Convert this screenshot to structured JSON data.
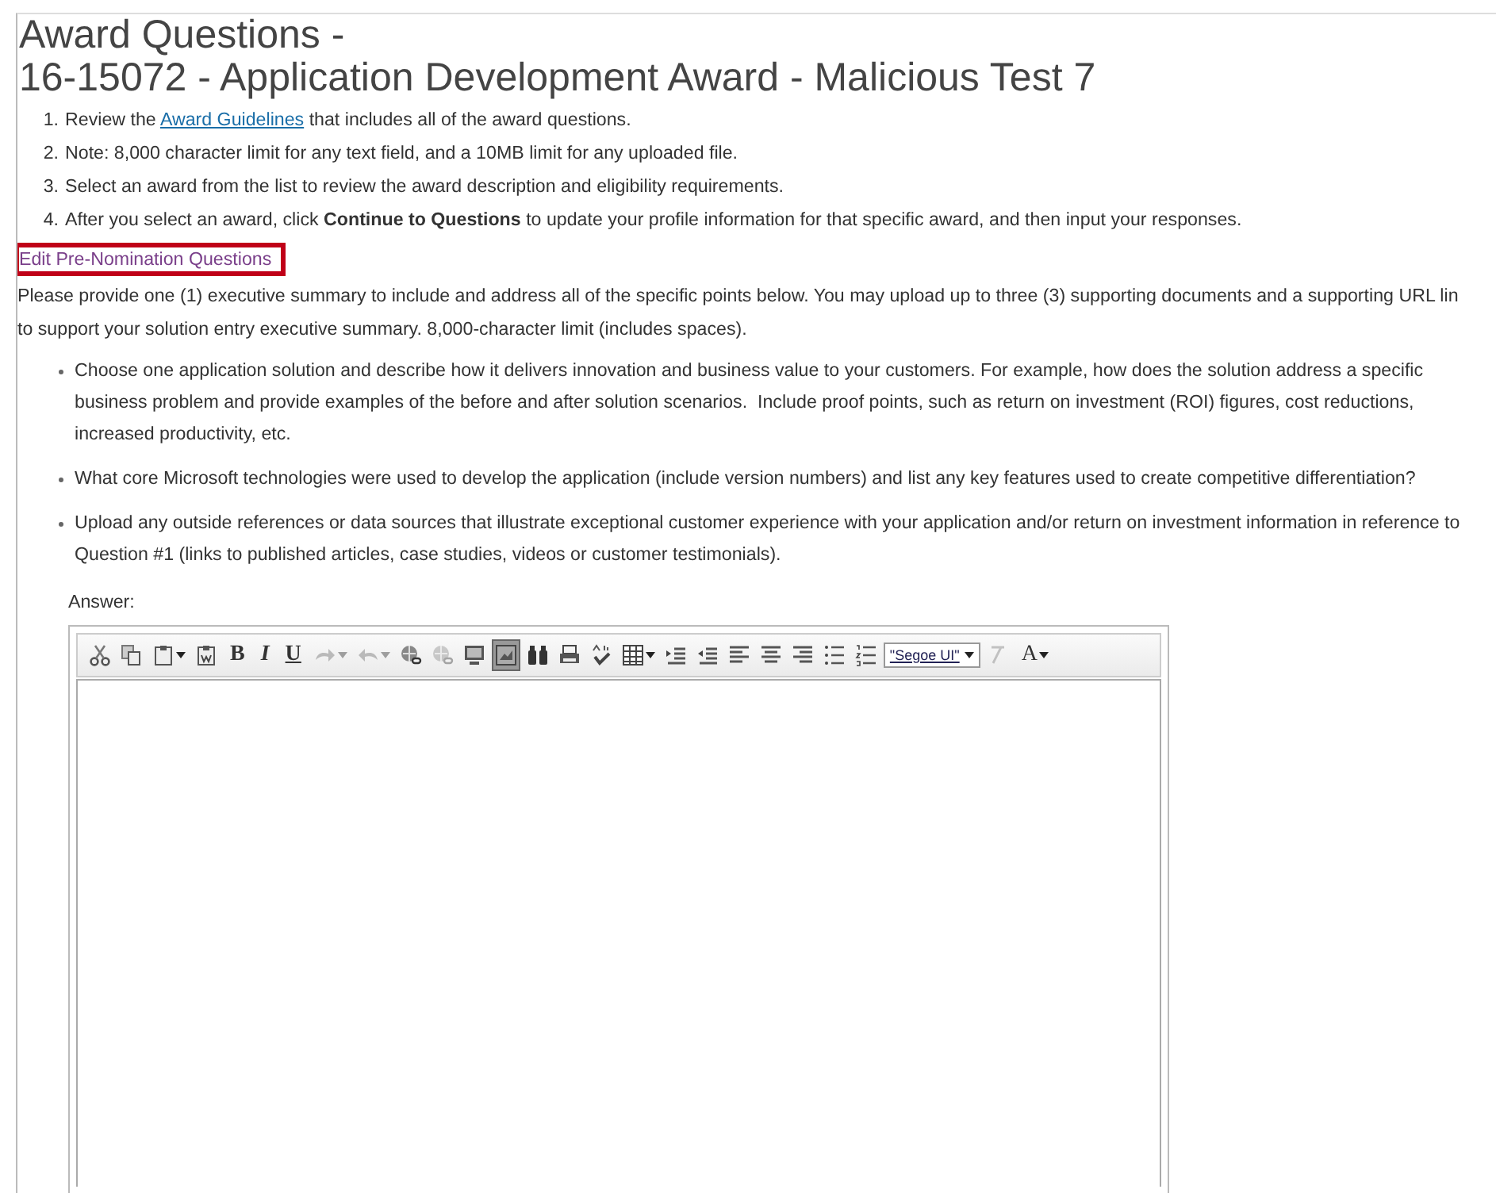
{
  "title": [
    "Award Questions -",
    "16-15072 - Application Development Award - Malicious Test 7"
  ],
  "steps": [
    {
      "number": "1.",
      "text": "Review the ",
      "link": "Award Guidelines",
      "text_after": " that includes all of the award questions."
    },
    {
      "number": "2.",
      "text": "Note: 8,000 character limit for any text field, and a 10MB limit for any uploaded file."
    },
    {
      "number": "3.",
      "text": "Select an award from the list to review the award description and eligibility requirements."
    },
    {
      "number": "4.",
      "text": "After you select an award, click **Continue to Questions** to update your profile information for that specific award, and then input your responses."
    }
  ],
  "section_link": {
    "label": "Edit Pre-Nomination Questions",
    "highlighted": true
  },
  "intro": "Please provide one (1) executive summary to include and address all of the specific points below.  You may upload up to three (3) supporting documents and a supporting URL lin\nto support your solution entry executive summary.  8,000-character limit (includes spaces).",
  "bullets": [
    "Choose one application solution and describe how it delivers innovation and business value to your customers. For example, how does the solution address a specific\nbusiness problem and provide examples of the before and after solution scenarios.  Include proof points, such as return on investment (ROI) figures, cost reductions,\nincreased productivity, etc.",
    "What core Microsoft technologies were used to develop the application (include version numbers) and list any key features used to create competitive differentiation?",
    "Upload any outside references or data sources that illustrate exceptional customer experience with your application and/or return on investment information in reference to\nQuestion #1 (links to published articles, case studies, videos or customer testimonials)."
  ],
  "answer_label": "Answer:",
  "toolbar": [
    {
      "kind": "icon",
      "dropdown": false,
      "disabled": false,
      "pressed": false
    },
    {
      "kind": "icon",
      "dropdown": false,
      "disabled": false,
      "pressed": false
    },
    {
      "kind": "icon",
      "dropdown": true,
      "disabled": false,
      "pressed": false
    },
    {
      "kind": "icon",
      "dropdown": false,
      "disabled": false,
      "pressed": false
    },
    {
      "kind": "text",
      "label": "B",
      "dropdown": false,
      "disabled": false,
      "pressed": false
    },
    {
      "kind": "text",
      "label": "I",
      "dropdown": false,
      "disabled": false,
      "pressed": false
    },
    {
      "kind": "text",
      "label": "U",
      "dropdown": false,
      "disabled": false,
      "pressed": false
    },
    {
      "kind": "icon",
      "dropdown": true,
      "disabled": true,
      "pressed": false
    },
    {
      "kind": "icon",
      "dropdown": true,
      "disabled": true,
      "pressed": false
    },
    {
      "kind": "icon",
      "dropdown": false,
      "disabled": false,
      "pressed": false
    },
    {
      "kind": "icon",
      "dropdown": false,
      "disabled": true,
      "pressed": false
    },
    {
      "kind": "icon",
      "dropdown": false,
      "disabled": false,
      "pressed": false
    },
    {
      "kind": "icon",
      "dropdown": false,
      "disabled": false,
      "pressed": true
    },
    {
      "kind": "icon",
      "dropdown": false,
      "disabled": false,
      "pressed": false
    },
    {
      "kind": "icon",
      "dropdown": false,
      "disabled": false,
      "pressed": false
    },
    {
      "kind": "icon",
      "dropdown": false,
      "disabled": false,
      "pressed": false
    },
    {
      "kind": "icon",
      "dropdown": true,
      "disabled": false,
      "pressed": false
    },
    {
      "kind": "icon",
      "dropdown": false,
      "disabled": false,
      "pressed": false
    },
    {
      "kind": "icon",
      "dropdown": false,
      "disabled": false,
      "pressed": false
    },
    {
      "kind": "icon",
      "dropdown": false,
      "disabled": false,
      "pressed": false
    },
    {
      "kind": "icon",
      "dropdown": false,
      "disabled": false,
      "pressed": false
    },
    {
      "kind": "icon",
      "dropdown": false,
      "disabled": false,
      "pressed": false
    },
    {
      "kind": "icon",
      "dropdown": false,
      "disabled": false,
      "pressed": false
    },
    {
      "kind": "icon",
      "dropdown": false,
      "disabled": false,
      "pressed": false
    },
    {
      "kind": "select",
      "label": "\"Segoe UI\"",
      "dropdown": true
    },
    {
      "kind": "icon",
      "dropdown": false,
      "disabled": true,
      "pressed": false
    },
    {
      "kind": "text",
      "label": "A",
      "dropdown": true,
      "disabled": false,
      "pressed": false
    }
  ]
}
